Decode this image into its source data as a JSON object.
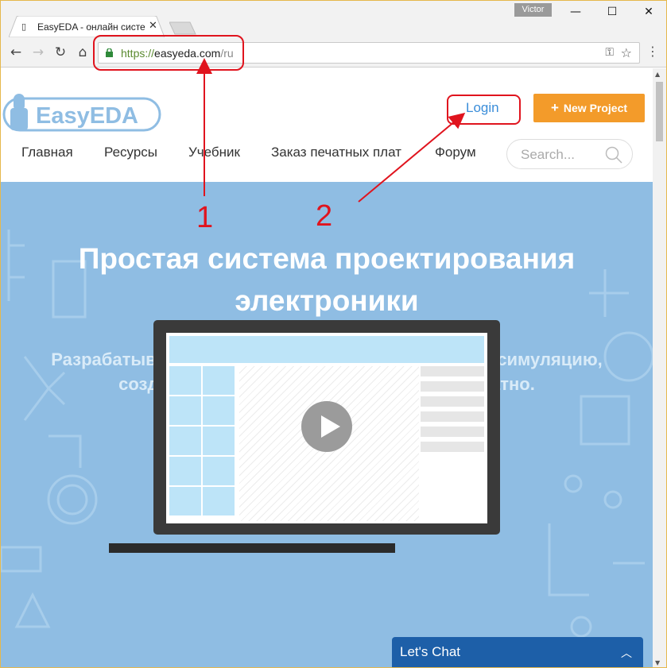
{
  "browser": {
    "tab_title": "EasyEDA - онлайн систе",
    "tab_favicon": "chip-icon",
    "profile_name": "Victor",
    "url_proto": "https://",
    "url_host": "easyeda.com",
    "url_path": "/ru",
    "window_controls": {
      "minimize": "—",
      "maximize": "☐",
      "close": "✕"
    }
  },
  "header": {
    "logo_text": "EasyEDA",
    "login_label": "Login",
    "new_project_label": "New Project",
    "search_placeholder": "Search...",
    "nav": [
      "Главная",
      "Ресурсы",
      "Учебник",
      "Заказ печатных плат",
      "Форум"
    ]
  },
  "hero": {
    "title_line1": "Простая система проектирования",
    "title_line2": "электроники",
    "subtitle_line1": "Разрабатывайте электронные схемы, выполняйте симуляцию,",
    "subtitle_line2": "создавайте печатные платы онлайн бесплатно."
  },
  "chat": {
    "label": "Let's Chat"
  },
  "annotations": {
    "marker1": "1",
    "marker2": "2"
  },
  "colors": {
    "accent_orange": "#f39b2a",
    "hero_blue": "#8fbde3",
    "chat_blue": "#1d5fa8",
    "annotation_red": "#e0141e",
    "link_blue": "#3a8dd9"
  }
}
